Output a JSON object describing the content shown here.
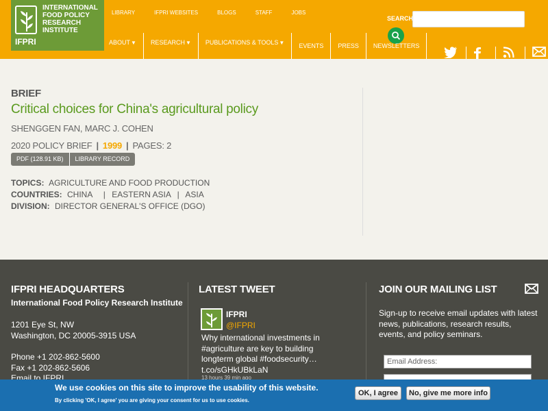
{
  "logo": {
    "name": "International Food Policy Research Institute",
    "abbr": "IFPRI"
  },
  "toplinks": [
    "LIBRARY",
    "IFPRI WEBSITES",
    "BLOGS",
    "STAFF",
    "JOBS"
  ],
  "search": {
    "label": "SEARCH"
  },
  "nav": {
    "about": "ABOUT",
    "research": "RESEARCH",
    "publications": "PUBLICATIONS & TOOLS",
    "events": "EVENTS",
    "press": "PRESS",
    "newsletters": "NEWSLETTERS"
  },
  "social": [
    "twitter-icon",
    "facebook-icon",
    "rss-icon",
    "email-icon"
  ],
  "colors": {
    "header": "#f5a800",
    "title_green": "#5a9a1e",
    "footer": "#4a4a44",
    "cookie_bar": "#1b6fb0"
  },
  "brief": {
    "type": "BRIEF",
    "title": "Critical choices for China's agricultural policy",
    "authors": "SHENGGEN FAN, MARC J. COHEN",
    "series": "2020 POLICY BRIEF",
    "year": "1999",
    "pages_label": "PAGES:",
    "pages": "2",
    "pdf_button": "PDF (128.91 KB)",
    "library_button": "LIBRARY RECORD",
    "topics_label": "TOPICS:",
    "topics": "AGRICULTURE AND FOOD PRODUCTION",
    "countries_label": "COUNTRIES:",
    "countries": [
      "CHINA",
      "EASTERN ASIA",
      "ASIA"
    ],
    "division_label": "DIVISION:",
    "division": "DIRECTOR GENERAL'S OFFICE (DGO)"
  },
  "footer": {
    "hq_title": "IFPRI HEADQUARTERS",
    "hq_org": "International Food Policy Research Institute",
    "address1": "1201 Eye St, NW",
    "address2": "Washington, DC 20005-3915 USA",
    "phone": "Phone +1 202-862-5600",
    "fax": "Fax +1 202-862-5606",
    "email": "Email to IFPRI",
    "tweet_title": "LATEST TWEET",
    "tweet_name": "IFPRI",
    "tweet_handle": "@IFPRI",
    "tweet_body": "Why international investments in #agriculture are key to building longterm global #foodsecurity… t.co/sGHkUBkLaN",
    "tweet_time": "13 hours 39 min ago",
    "mailing_title": "JOIN OUR MAILING LIST",
    "mailing_text": "Sign-up to receive email updates with latest news, publications, research results, events, and policy seminars.",
    "email_placeholder": "Email Address:"
  },
  "cookie": {
    "title": "We use cookies on this site to improve the usability of this website.",
    "subtitle": "By clicking 'OK, I agree' you are giving your consent for us to use cookies.",
    "ok": "OK, I agree",
    "no": "No, give me more info"
  }
}
